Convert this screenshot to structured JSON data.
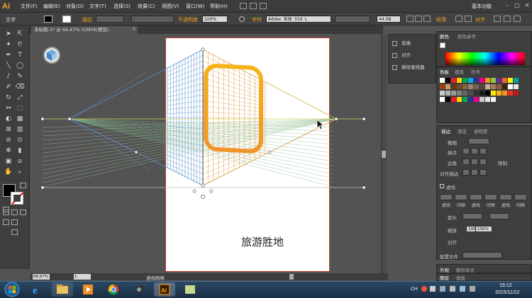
{
  "menubar": {
    "logo": "Ai",
    "items": [
      "文件(F)",
      "编辑(E)",
      "对象(O)",
      "文字(T)",
      "选择(S)",
      "效果(C)",
      "视图(V)",
      "窗口(W)",
      "帮助(H)"
    ],
    "workspace": "基本功能"
  },
  "control_bar": {
    "tool_label": "文字",
    "stroke_label": "描边",
    "opacity_label": "不透明度",
    "opacity_value": "100%",
    "char_label": "字符",
    "font_value": "Adobe 宋体 Std L",
    "size_value": "44.08",
    "paragraph_label": "段落",
    "align_label": "对齐"
  },
  "document": {
    "tab_title": "未标题-1* @ 66.67% (CMYK/预览)",
    "artboard_text": "旅游胜地"
  },
  "status": {
    "zoom": "66.67%",
    "page": "1",
    "tool_text": "透视网格"
  },
  "mid_panel": {
    "items": [
      "变换",
      "对齐",
      "路径查找器"
    ]
  },
  "right_panel": {
    "color_tabs": [
      "颜色",
      "颜色参考"
    ],
    "swatch_tabs": [
      "色板",
      "画笔",
      "符号"
    ],
    "stroke_tabs": [
      "描边",
      "渐变",
      "透明度"
    ],
    "weight_label": "粗细",
    "cap_label": "端点",
    "corner_label": "边角",
    "limit_label": "限制",
    "align_stroke_label": "对齐描边",
    "dashed_label": "虚线",
    "dash_labels": [
      "虚线",
      "间隙",
      "虚线",
      "间隙",
      "虚线",
      "间隙"
    ],
    "arrow_label": "箭头",
    "scale_label": "缩放",
    "scale_value_1": "100%",
    "scale_value_2": "100%",
    "align_label": "对齐",
    "profile_label": "配置文件",
    "bottom_tabs": [
      "外观",
      "图形样式"
    ],
    "layer_tabs": [
      "图层",
      "画板"
    ]
  },
  "taskbar": {
    "lang": "CH",
    "time": "15:12",
    "date": "2015/11/22"
  },
  "colors": {
    "ui_bg": "#535353",
    "panel_bg": "#3e3e3e",
    "accent_orange": "#f7a21b",
    "artboard_border": "#c43f2a"
  },
  "swatches": [
    "#ffffff",
    "#000000",
    "#ed1c24",
    "#ffd200",
    "#00a651",
    "#00aeef",
    "#2e3192",
    "#ec008c",
    "#f7941d",
    "#8dc63f",
    "#662d91",
    "#f26522",
    "#fff200",
    "#00a99d",
    "#a0410d",
    "#c69c6d",
    "#603913",
    "#754c24",
    "#8c6239",
    "#998675",
    "#736357",
    "#534741",
    "#c7b299",
    "#a67c52",
    "#8b5e3c",
    "#42210b",
    "#ffffff",
    "#e6e6e6",
    "#cccccc",
    "#b3b3b3",
    "#999999",
    "#808080",
    "#666666",
    "#4d4d4d",
    "#333333",
    "#1a1a1a",
    "#000000",
    "#ffe600",
    "#fcb316",
    "#f7941d",
    "#ee2f24",
    "#c4161c",
    "#ffffff",
    "#000000",
    "#ed1c24",
    "#ffd200",
    "#00a651",
    "#2e3192",
    "#ec008c",
    "#cccccc",
    "#e6e6e6",
    "#f2f2f2"
  ]
}
